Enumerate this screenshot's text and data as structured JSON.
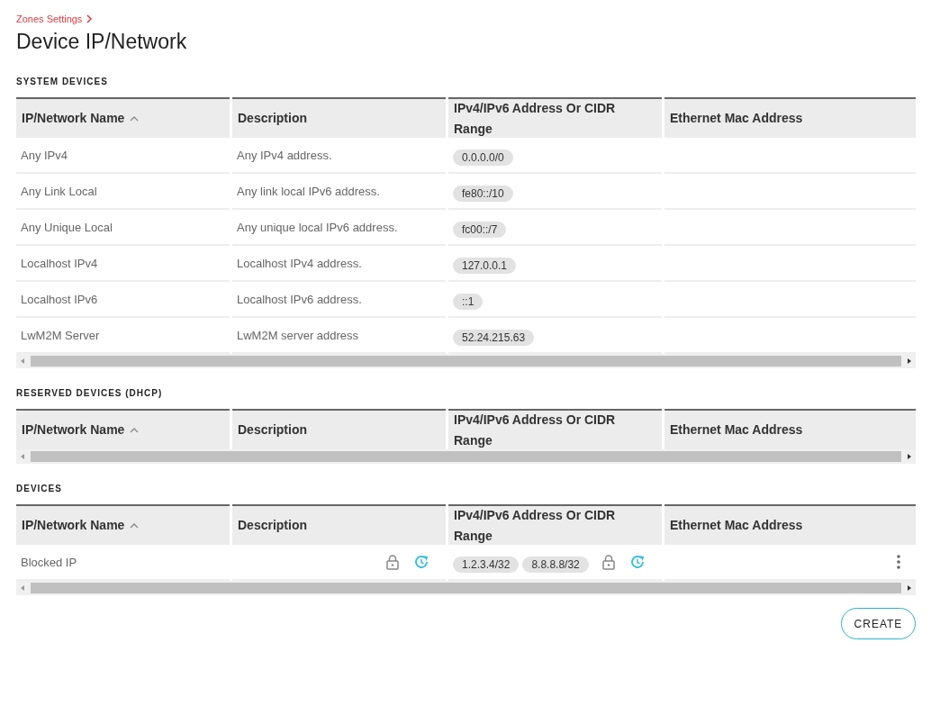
{
  "breadcrumb": "Zones Settings",
  "title": "Device IP/Network",
  "sections": [
    {
      "heading": "SYSTEM DEVICES",
      "columns": [
        {
          "label": "IP/Network Name",
          "sorted": true
        },
        {
          "label": "Description"
        },
        {
          "label": "IPv4/IPv6 Address Or CIDR Range"
        },
        {
          "label": "Ethernet Mac Address"
        }
      ],
      "rows": [
        {
          "kind": "system",
          "name": "Any IPv4",
          "description": "Any IPv4 address.",
          "addresses": [
            "0.0.0.0/0"
          ]
        },
        {
          "kind": "system",
          "name": "Any Link Local",
          "description": "Any link local IPv6 address.",
          "addresses": [
            "fe80::/10"
          ]
        },
        {
          "kind": "system",
          "name": "Any Unique Local",
          "description": "Any unique local IPv6 address.",
          "addresses": [
            "fc00::/7"
          ]
        },
        {
          "kind": "system",
          "name": "Localhost IPv4",
          "description": "Localhost IPv4 address.",
          "addresses": [
            "127.0.0.1"
          ]
        },
        {
          "kind": "system",
          "name": "Localhost IPv6",
          "description": "Localhost IPv6 address.",
          "addresses": [
            "::1"
          ]
        },
        {
          "kind": "system",
          "name": "LwM2M Server",
          "description": "LwM2M server address",
          "addresses": [
            "52.24.215.63"
          ]
        }
      ]
    },
    {
      "heading": "RESERVED DEVICES (DHCP)",
      "columns": [
        {
          "label": "IP/Network Name",
          "sorted": true
        },
        {
          "label": "Description"
        },
        {
          "label": "IPv4/IPv6 Address Or CIDR Range"
        },
        {
          "label": "Ethernet Mac Address"
        }
      ]
    },
    {
      "heading": "DEVICES",
      "columns": [
        {
          "label": "IP/Network Name",
          "sorted": true
        },
        {
          "label": "Description"
        },
        {
          "label": "IPv4/IPv6 Address Or CIDR Range"
        },
        {
          "label": "Ethernet Mac Address"
        }
      ],
      "rows": [
        {
          "kind": "custom",
          "name": "Blocked IP",
          "addresses": [
            "1.2.3.4/32",
            "8.8.8.8/32"
          ]
        }
      ]
    }
  ],
  "create_button": "CREATE"
}
